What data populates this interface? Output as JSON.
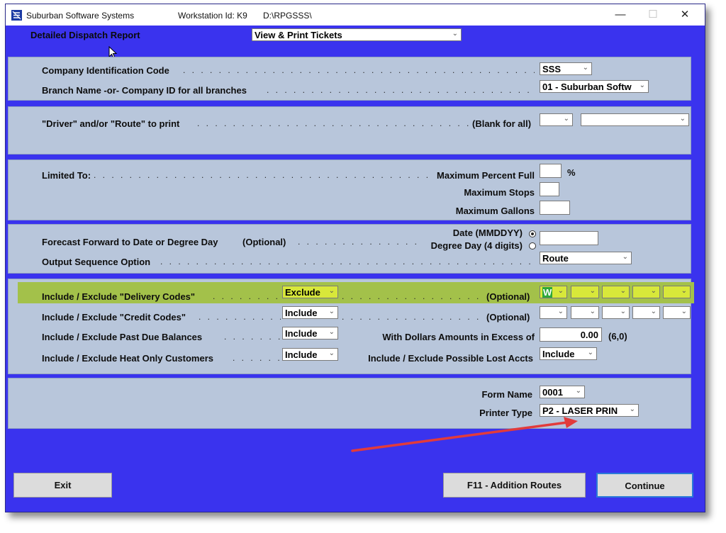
{
  "window": {
    "app_title": "Suburban Software Systems",
    "workstation": "Workstation Id: K9",
    "path": "D:\\RPGSSS\\",
    "minimize": "—",
    "maximize": "☐",
    "close": "✕"
  },
  "header": {
    "report_title": "Detailed Dispatch Report",
    "mode_value": "View & Print Tickets"
  },
  "company": {
    "code_label": "Company Identification Code",
    "code_value": "SSS",
    "branch_label": "Branch Name -or- Company ID for all branches",
    "branch_value": "01 - Suburban Softw"
  },
  "driver": {
    "label": "\"Driver\"  and/or  \"Route\"  to print",
    "blank_note": "(Blank for all)",
    "driver_value": "",
    "route_value": ""
  },
  "limits": {
    "label": "Limited To:",
    "max_percent_label": "Maximum Percent Full",
    "percent_sign": "%",
    "max_stops_label": "Maximum Stops",
    "max_gallons_label": "Maximum Gallons",
    "max_percent_value": "",
    "max_stops_value": "",
    "max_gallons_value": ""
  },
  "forecast": {
    "label": "Forecast Forward to Date or Degree Day",
    "optional": "(Optional)",
    "date_label": "Date (MMDDYY)",
    "degree_label": "Degree Day (4 digits)",
    "selected": "date",
    "value": "",
    "sequence_label": "Output Sequence Option",
    "sequence_value": "Route"
  },
  "codes": {
    "delivery_label": "Include / Exclude \"Delivery Codes\"",
    "delivery_value": "Exclude",
    "delivery_optional": "(Optional)",
    "delivery_codes": [
      "W",
      "",
      "",
      "",
      ""
    ],
    "credit_label": "Include / Exclude \"Credit Codes\"",
    "credit_value": "Include",
    "credit_optional": "(Optional)",
    "credit_codes": [
      "",
      "",
      "",
      "",
      ""
    ],
    "pastdue_label": "Include / Exclude Past Due Balances",
    "pastdue_value": "Include",
    "dollars_label": "With Dollars Amounts in Excess of",
    "dollars_value": "0.00",
    "dollars_format": "(6,0)",
    "heat_label": "Include / Exclude Heat Only Customers",
    "heat_value": "Include",
    "lost_label": "Include / Exclude Possible Lost Accts",
    "lost_value": "Include"
  },
  "form": {
    "name_label": "Form Name",
    "name_value": "0001",
    "printer_label": "Printer Type",
    "printer_value": "P2 - LASER PRIN"
  },
  "buttons": {
    "exit": "Exit",
    "f11": "F11 - Addition Routes",
    "continue": "Continue"
  },
  "colors": {
    "window_bg": "#3a33ee",
    "panel_bg": "#b8c6db",
    "highlight_row": "#a3c14a",
    "arrow": "#e23b3b"
  }
}
